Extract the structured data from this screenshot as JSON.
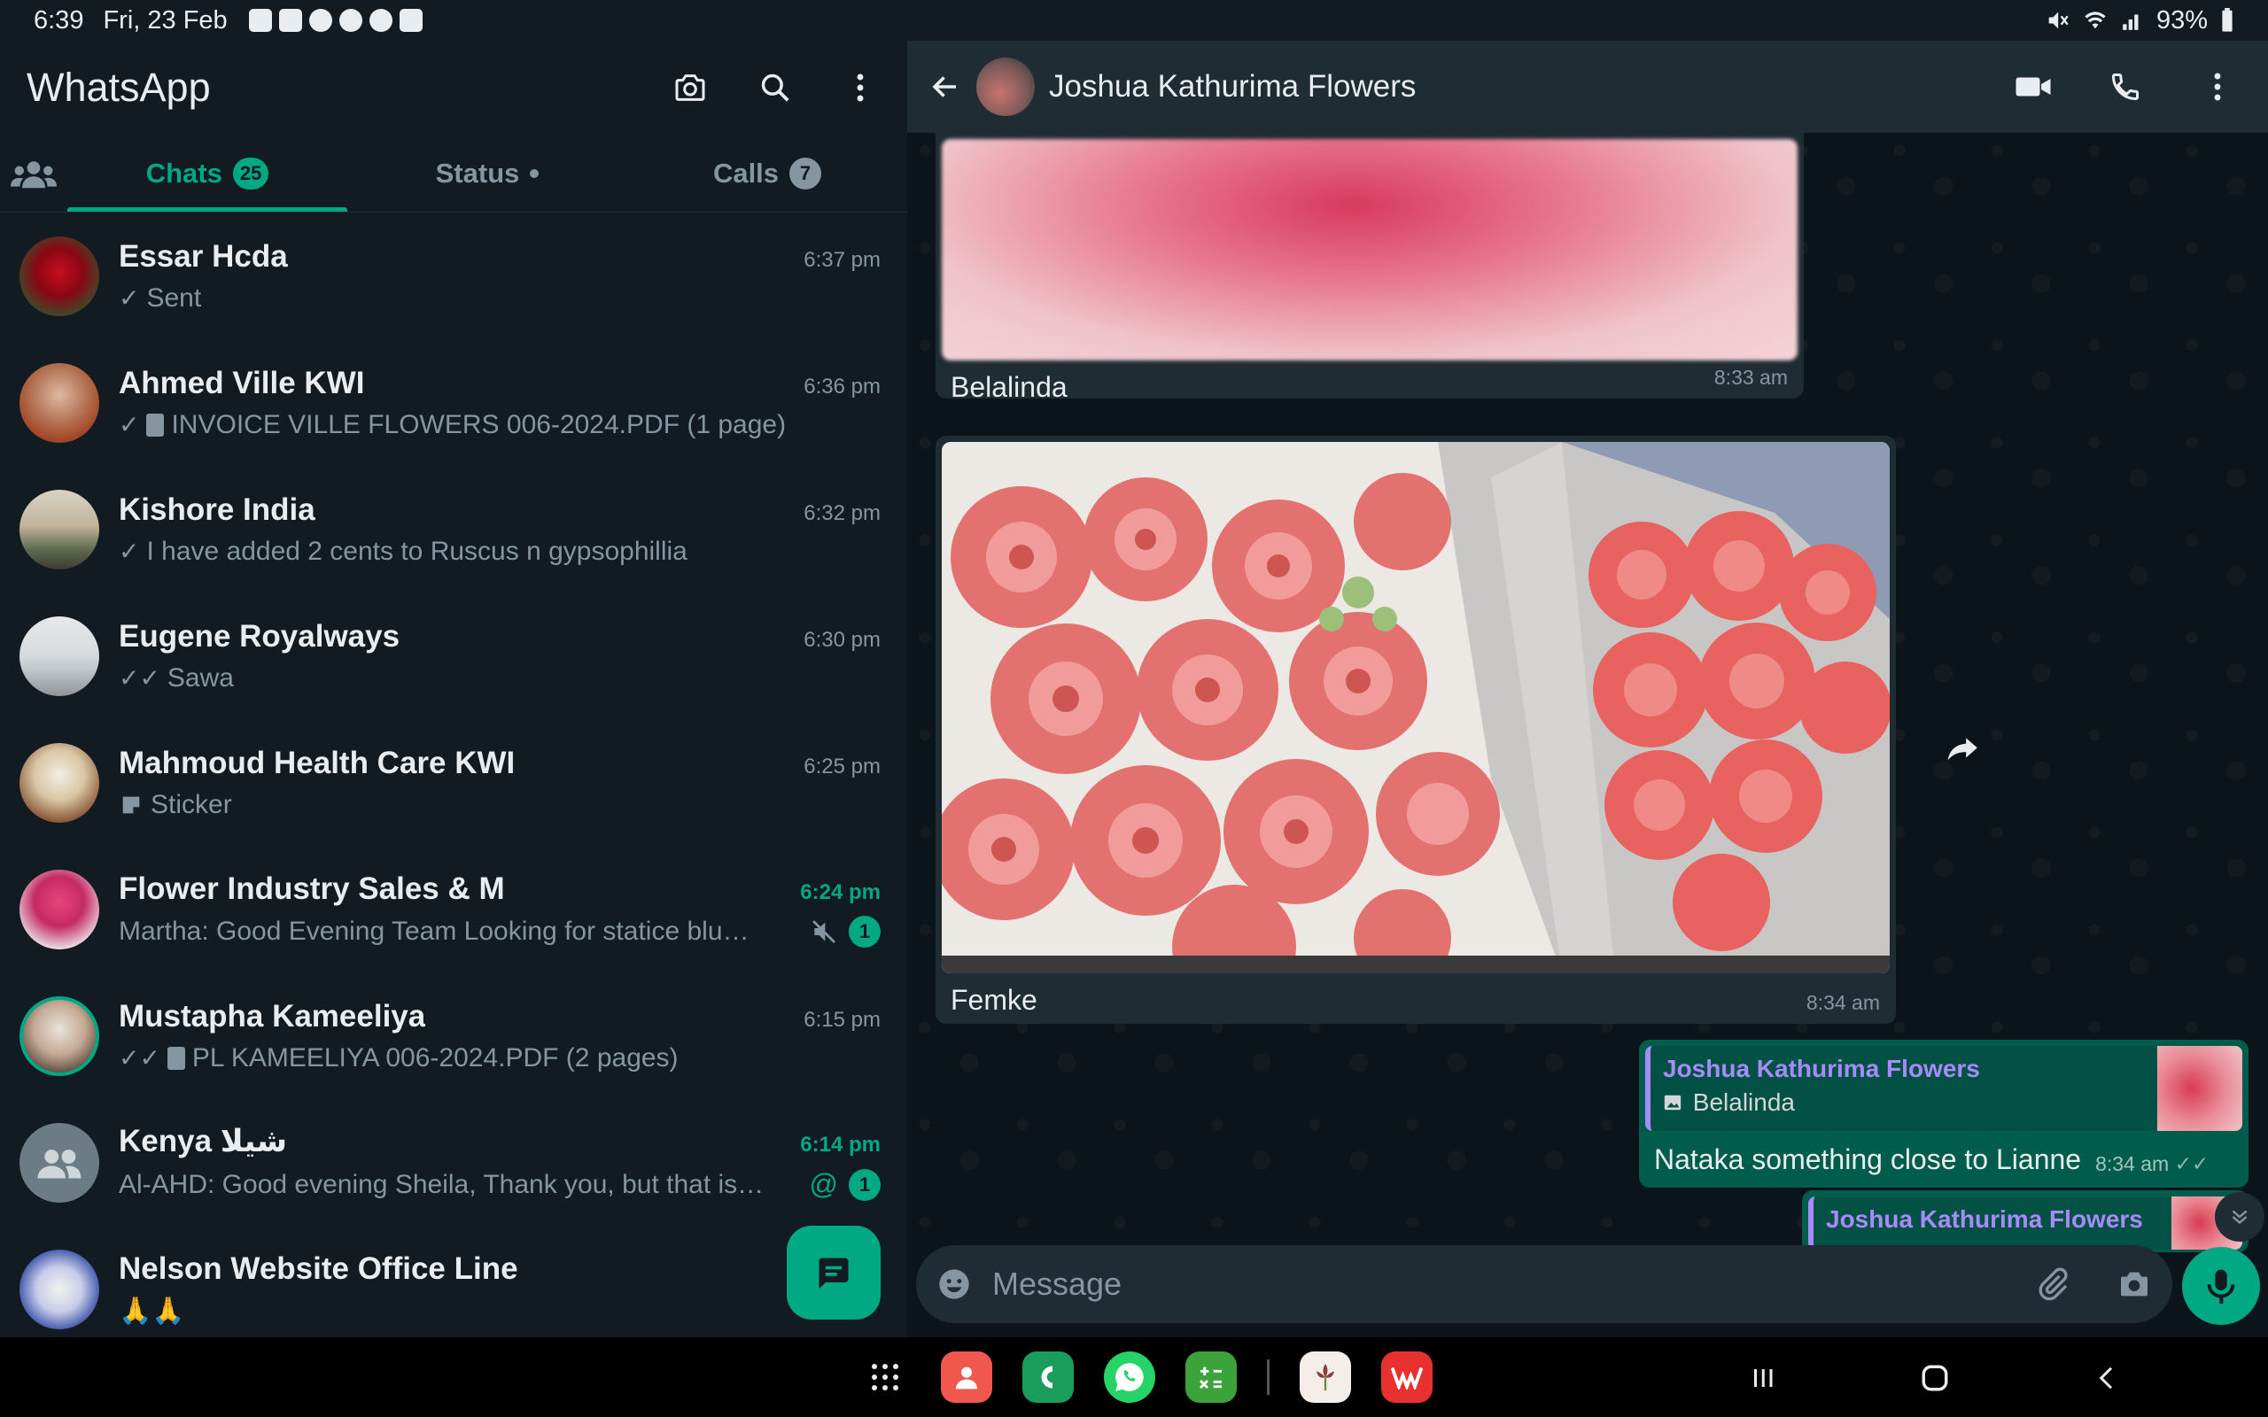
{
  "status_bar": {
    "time": "6:39",
    "date": "Fri, 23 Feb",
    "battery": "93%"
  },
  "left": {
    "app_title": "WhatsApp",
    "tabs": {
      "chats_label": "Chats",
      "chats_count": "25",
      "status_label": "Status",
      "calls_label": "Calls",
      "calls_count": "7"
    },
    "chats": [
      {
        "name": "Essar Hcda",
        "time": "6:37 pm",
        "tick": "✓",
        "preview": "Sent"
      },
      {
        "name": "Ahmed Ville KWI",
        "time": "6:36 pm",
        "tick": "✓",
        "preview": "INVOICE VILLE FLOWERS 006-2024.PDF (1 page)"
      },
      {
        "name": "Kishore India",
        "time": "6:32 pm",
        "tick": "✓",
        "preview": "I have added 2 cents to Ruscus n gypsophillia"
      },
      {
        "name": "Eugene Royalways",
        "time": "6:30 pm",
        "tick": "✓✓",
        "preview": "Sawa"
      },
      {
        "name": "Mahmoud Health Care KWI",
        "time": "6:25 pm",
        "tick": "",
        "preview": "Sticker"
      },
      {
        "name": "Flower Industry Sales & M",
        "time": "6:24 pm",
        "tick": "",
        "preview": "Martha: Good Evening Team  Looking for statice blu…",
        "unread": "1"
      },
      {
        "name": "Mustapha Kameeliya",
        "time": "6:15 pm",
        "tick": "✓✓",
        "preview": "PL KAMEELIYA 006-2024.PDF (2 pages)"
      },
      {
        "name": "Kenya  شيلا",
        "time": "6:14 pm",
        "tick": "",
        "preview": "Al-AHD: Good evening Sheila, Thank you, but that is…",
        "mention": "@",
        "unread": "1"
      },
      {
        "name": "Nelson Website Office Line",
        "time": "",
        "tick": "",
        "preview": "🙏🙏"
      }
    ]
  },
  "right": {
    "contact_name": "Joshua Kathurima Flowers",
    "messages": {
      "m1_caption": "Belalinda",
      "m1_time": "8:33 am",
      "m2_caption": "Femke",
      "m2_time": "8:34 am",
      "reply1_quote_name": "Joshua Kathurima Flowers",
      "reply1_quote_sub": "Belalinda",
      "reply1_text": "Nataka something close to Lianne",
      "reply1_time": "8:34 am",
      "reply2_quote_name": "Joshua Kathurima Flowers"
    },
    "composer_placeholder": "Message"
  },
  "colors": {
    "accent": "#00a884",
    "outgoing_bubble": "#005c4b",
    "incoming_bubble": "#1f2c34",
    "quote_name": "#a78bfa"
  }
}
